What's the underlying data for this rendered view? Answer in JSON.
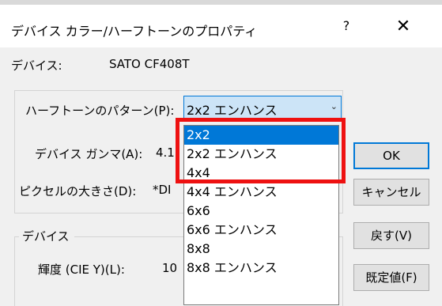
{
  "window": {
    "title": "デバイス カラー/ハーフトーンのプロパティ",
    "help_label": "?",
    "close_label": "✕"
  },
  "device_row": {
    "label": "デバイス:",
    "value": "SATO CF408T"
  },
  "halftone_group": {
    "pattern_label": "ハーフトーンのパターン(P):",
    "pattern_value": "2x2 エンハンス",
    "gamma_label": "デバイス ガンマ(A):",
    "gamma_value": "4.1",
    "pixel_label": "ピクセルの大きさ(D):",
    "pixel_value": "*DI"
  },
  "device_group": {
    "legend": "デバイス",
    "luminance_label": "輝度 (CIE Y)(L):",
    "luminance_value": "10"
  },
  "dropdown": {
    "options": [
      "2x2",
      "2x2 エンハンス",
      "4x4",
      "4x4 エンハンス",
      "6x6",
      "6x6 エンハンス",
      "8x8",
      "8x8 エンハンス"
    ],
    "selected": "2x2"
  },
  "buttons": {
    "ok": "OK",
    "cancel": "キャンセル",
    "revert": "戻す(V)",
    "defaults": "既定値(F)"
  },
  "colors": {
    "accent": "#0078d7",
    "highlight_box": "#ee1111"
  }
}
